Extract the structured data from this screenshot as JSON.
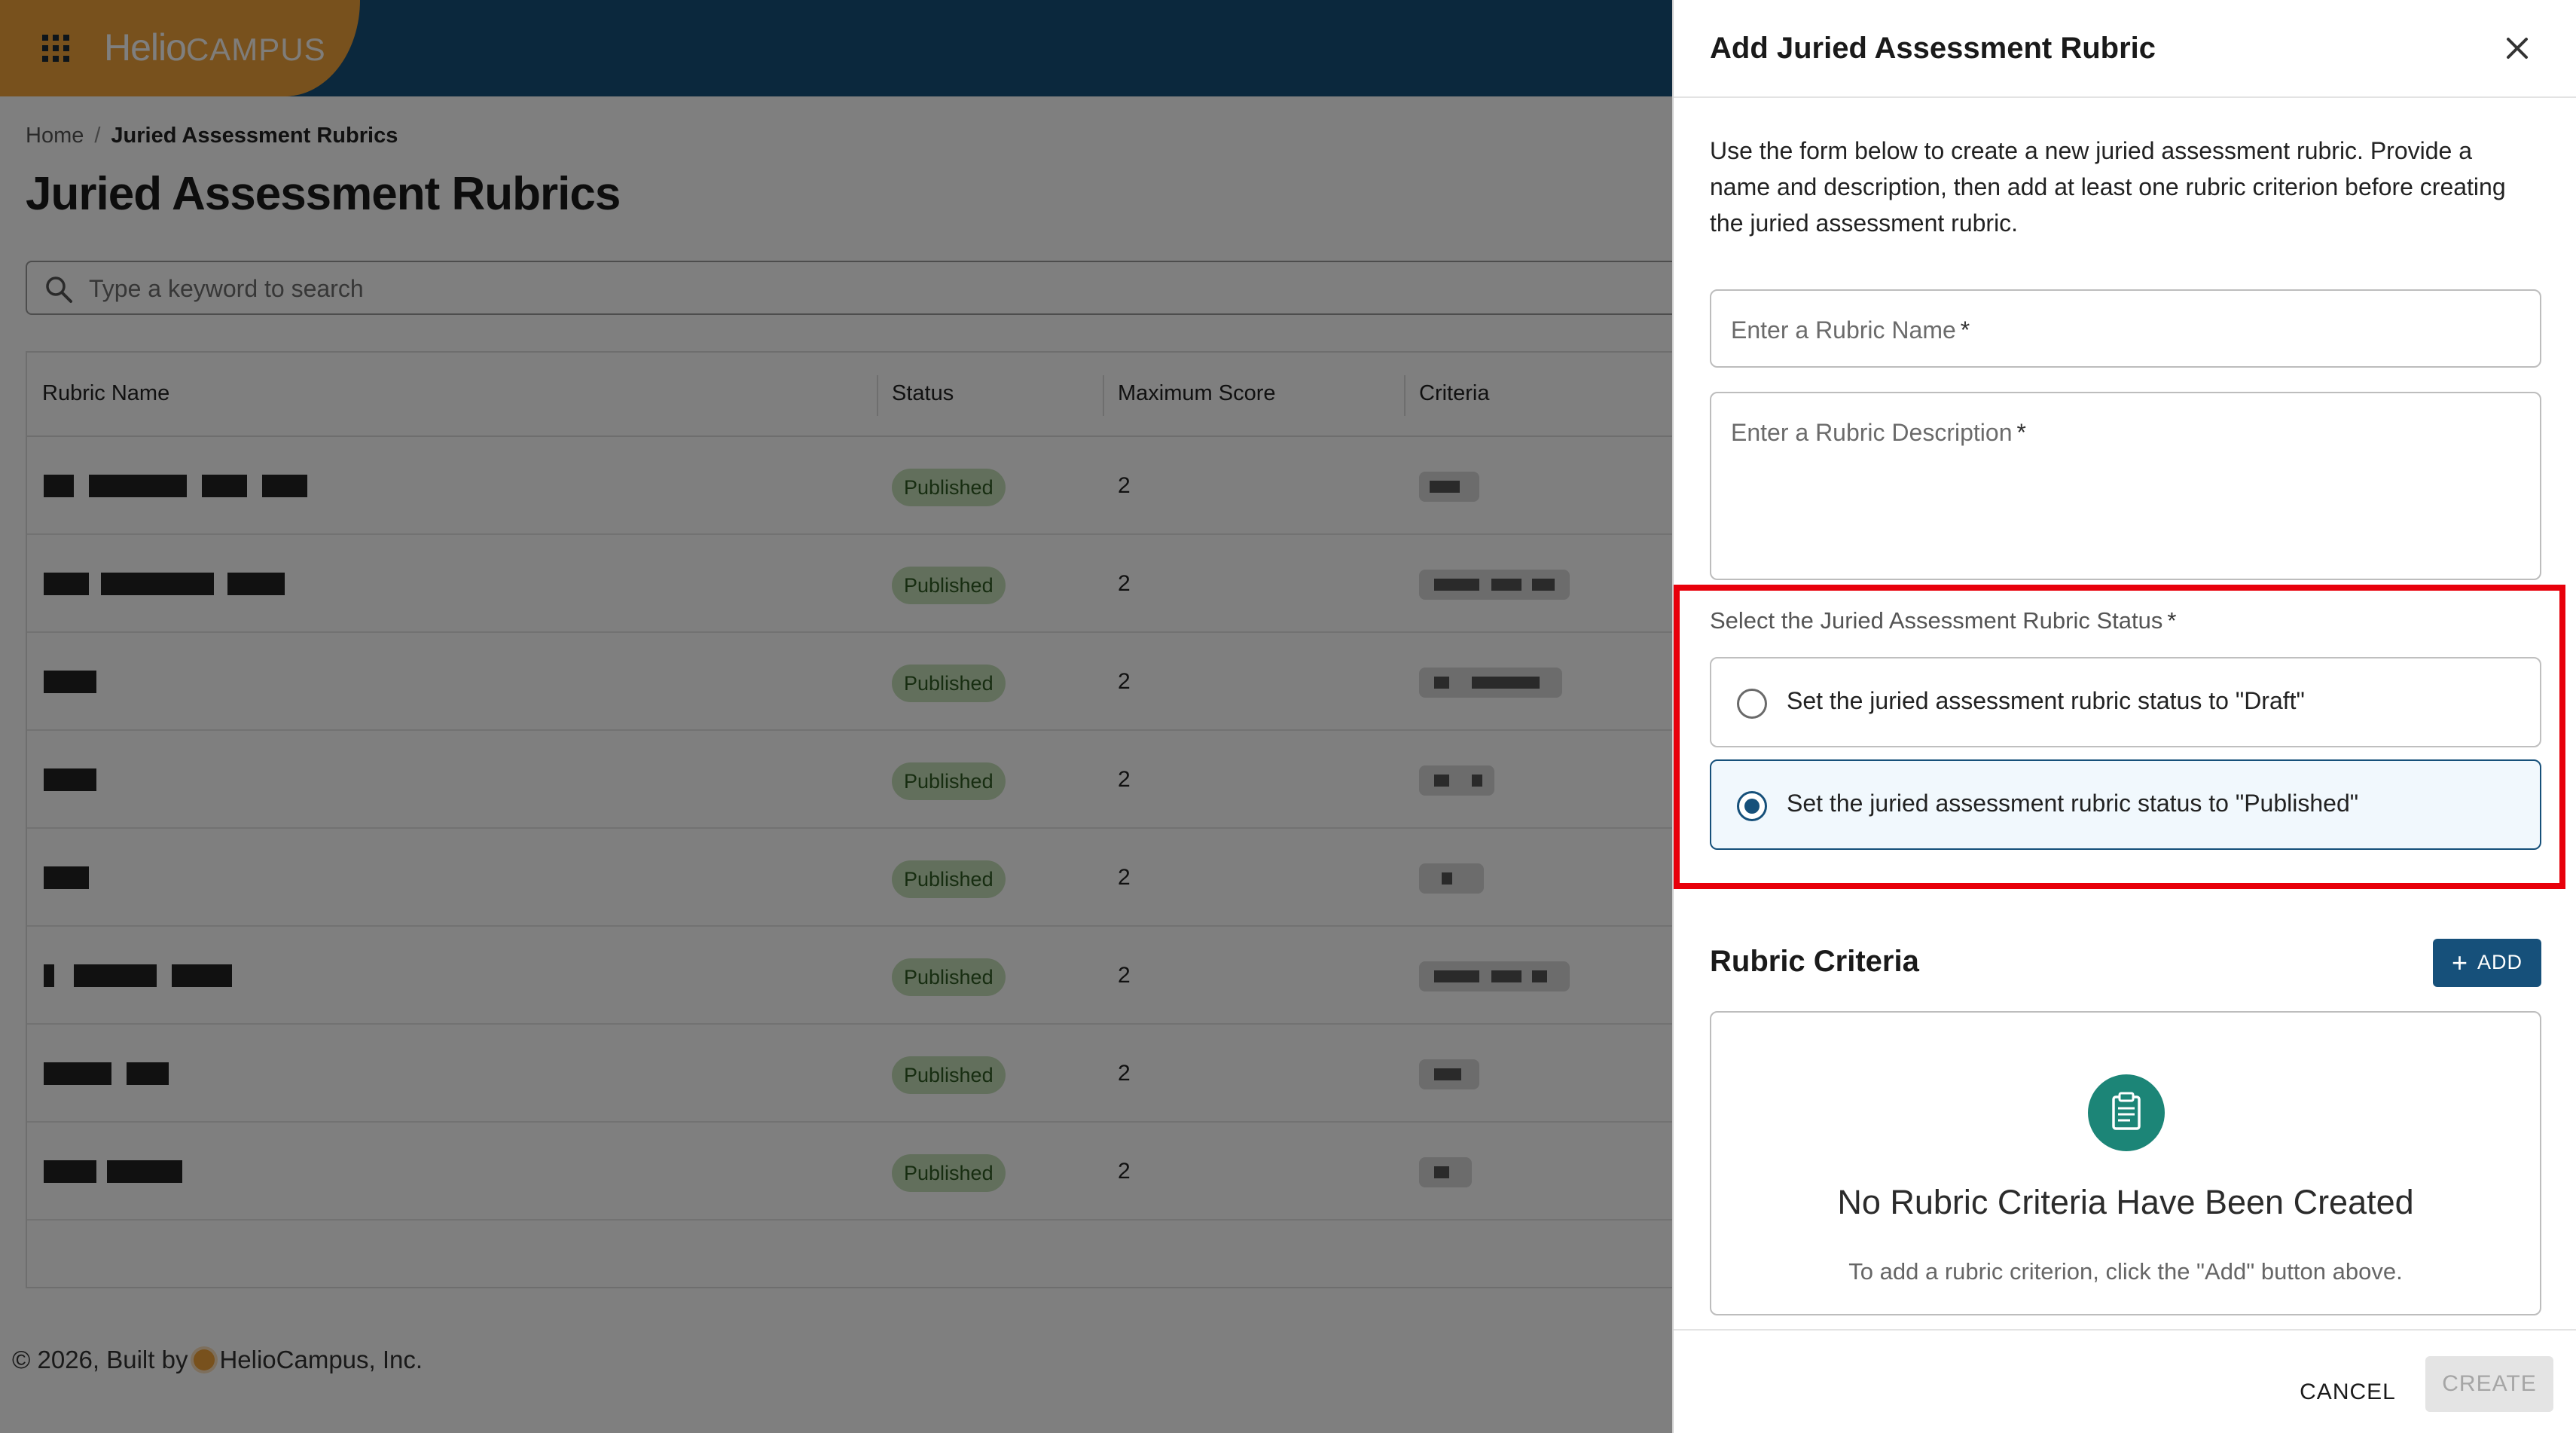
{
  "app": {
    "logo_main": "Helio",
    "logo_sub": "CAMPUS",
    "menu_icon": "apps-grid-icon"
  },
  "breadcrumb": {
    "home": "Home",
    "separator": "/",
    "current": "Juried Assessment Rubrics"
  },
  "page_title": "Juried Assessment Rubrics",
  "search": {
    "placeholder": "Type a keyword to search",
    "icon": "search-icon"
  },
  "table": {
    "columns": [
      "Rubric Name",
      "Status",
      "Maximum Score",
      "Criteria"
    ],
    "rows": [
      {
        "status": "Published",
        "max_score": "2"
      },
      {
        "status": "Published",
        "max_score": "2"
      },
      {
        "status": "Published",
        "max_score": "2"
      },
      {
        "status": "Published",
        "max_score": "2"
      },
      {
        "status": "Published",
        "max_score": "2"
      },
      {
        "status": "Published",
        "max_score": "2"
      },
      {
        "status": "Published",
        "max_score": "2"
      },
      {
        "status": "Published",
        "max_score": "2"
      }
    ]
  },
  "footer": {
    "prefix": "© 2026, Built by",
    "company": "HelioCampus, Inc."
  },
  "drawer": {
    "title": "Add Juried Assessment Rubric",
    "close_icon": "close-icon",
    "description": "Use the form below to create a new juried assessment rubric. Provide a name and description, then add at least one rubric criterion before creating the juried assessment rubric.",
    "name_field": {
      "placeholder": "Enter a Rubric Name",
      "required_mark": "*",
      "value": ""
    },
    "description_field": {
      "placeholder": "Enter a Rubric Description",
      "required_mark": "*",
      "value": ""
    },
    "status_group": {
      "label": "Select the Juried Assessment Rubric Status",
      "required_mark": "*",
      "options": [
        {
          "label": "Set the juried assessment rubric status to \"Draft\"",
          "selected": false
        },
        {
          "label": "Set the juried assessment rubric status to \"Published\"",
          "selected": true
        }
      ]
    },
    "criteria": {
      "title": "Rubric Criteria",
      "add_label": "ADD",
      "add_icon": "plus-icon",
      "empty_icon": "clipboard-icon",
      "empty_title": "No Rubric Criteria Have Been Created",
      "empty_subtitle": "To add a rubric criterion, click the \"Add\" button above."
    },
    "actions": {
      "cancel": "CANCEL",
      "create": "CREATE"
    }
  },
  "colors": {
    "topbar": "#16507a",
    "brand": "#f0a23a",
    "primary_button": "#16507a",
    "published_badge_bg": "#c5dfb8",
    "empty_icon_bg": "#1c8577",
    "highlight_border": "#e8000b"
  }
}
